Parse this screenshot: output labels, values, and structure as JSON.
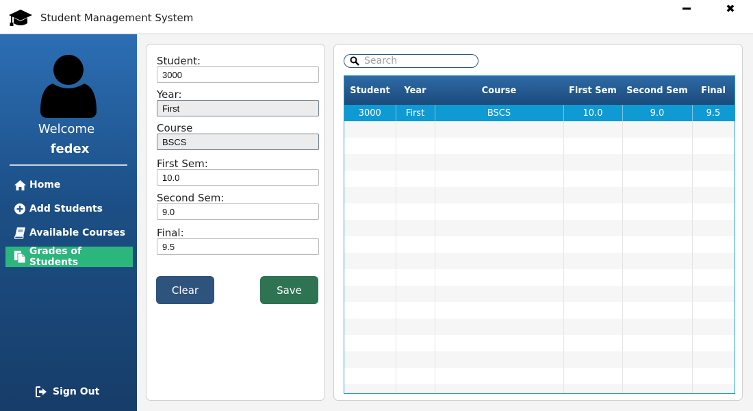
{
  "window": {
    "title": "Student Management System",
    "icon": "graduation-cap-icon"
  },
  "sidebar": {
    "welcome": "Welcome",
    "username": "fedex",
    "items": [
      {
        "label": "Home",
        "icon": "home-icon"
      },
      {
        "label": "Add Students",
        "icon": "plus-circle-icon"
      },
      {
        "label": "Available Courses",
        "icon": "book-icon"
      },
      {
        "label": "Grades of Students",
        "icon": "copy-icon",
        "active": true
      }
    ],
    "signout": "Sign Out",
    "active_color": "#2cb67d"
  },
  "form": {
    "student_label": "Student:",
    "student_value": "3000",
    "year_label": "Year:",
    "year_value": "First",
    "course_label": "Course",
    "course_value": "BSCS",
    "first_sem_label": "First Sem:",
    "first_sem_value": "10.0",
    "second_sem_label": "Second Sem:",
    "second_sem_value": "9.0",
    "final_label": "Final:",
    "final_value": "9.5",
    "clear_label": "Clear",
    "save_label": "Save"
  },
  "table": {
    "search_placeholder": "Search",
    "columns": [
      "Student",
      "Year",
      "Course",
      "First Sem",
      "Second Sem",
      "Final"
    ],
    "rows": [
      [
        "3000",
        "First",
        "BSCS",
        "10.0",
        "9.0",
        "9.5"
      ]
    ],
    "selected_row": 0,
    "selection_color": "#0f9ad3"
  }
}
